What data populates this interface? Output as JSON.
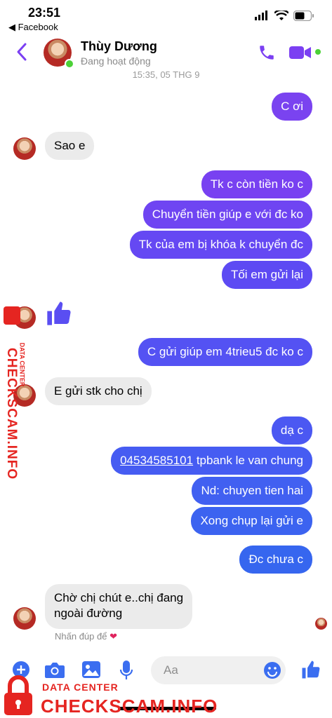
{
  "status_bar": {
    "time": "23:51",
    "back_app": "◀ Facebook"
  },
  "header": {
    "name": "Thùy Dương",
    "status": "Đang hoạt động"
  },
  "timestamp": "15:35, 05 THG 9",
  "messages": [
    {
      "dir": "out",
      "text": "C ơi"
    },
    {
      "dir": "in",
      "text": "Sao e"
    },
    {
      "dir": "out",
      "text": "Tk c còn tiền ko c"
    },
    {
      "dir": "out",
      "text": "Chuyển tiền giúp e với đc ko"
    },
    {
      "dir": "out",
      "text": "Tk của em bị khóa k chuyển đc"
    },
    {
      "dir": "out",
      "text": "Tối em gửi lại"
    },
    {
      "dir": "in",
      "sticker": "like-icon"
    },
    {
      "dir": "out",
      "text": "C gửi giúp em 4trieu5 đc ko c"
    },
    {
      "dir": "in",
      "text": "E gửi stk cho chị"
    },
    {
      "dir": "out",
      "text": "dạ c"
    },
    {
      "dir": "out",
      "link": "04534585101",
      "text": " tpbank le van chung"
    },
    {
      "dir": "out",
      "text": "Nd: chuyen tien hai"
    },
    {
      "dir": "out",
      "text": "Xong chụp lại gửi e"
    },
    {
      "dir": "out",
      "text": "Đc chưa c"
    },
    {
      "dir": "in",
      "text": "Chờ chị chút e..chị đang",
      "text2": "ngoài đường"
    }
  ],
  "reaction_hint": "Nhấn đúp để",
  "composer": {
    "placeholder": "Aa"
  },
  "watermark": {
    "side_small": "DATA CENTER",
    "side_big": "CHECKSCAM.INFO",
    "bottom_small": "DATA CENTER",
    "bottom_big": "CHECKSCAM.INFO"
  },
  "colors": {
    "accent": "#7b3ff2",
    "bubble_top": "#8a3ff0",
    "bubble_bottom": "#2f67ef",
    "incoming": "#ebebeb",
    "watermark": "#e52521"
  }
}
